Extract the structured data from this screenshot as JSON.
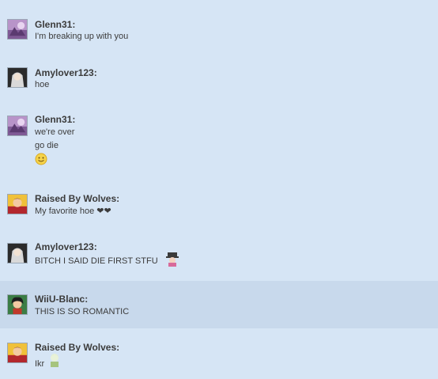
{
  "messages": [
    {
      "user": "Glenn31:",
      "lines": [
        "I'm breaking up with you"
      ]
    },
    {
      "user": "Amylover123:",
      "lines": [
        "hoe"
      ]
    },
    {
      "user": "Glenn31:",
      "lines": [
        "we're over",
        "go die"
      ],
      "emoji": "smiley-emoji"
    },
    {
      "user": "Raised By Wolves:",
      "lines": [
        "My favorite hoe ❤❤"
      ]
    },
    {
      "user": "Amylover123:",
      "lines": [
        "BITCH I SAID DIE FIRST STFU"
      ],
      "emoji": "character-sticker-emoji"
    },
    {
      "user": "WiiU-Blanc:",
      "lines": [
        "THIS IS SO ROMANTIC"
      ]
    },
    {
      "user": "Raised By Wolves:",
      "lines": [
        "Ikr"
      ],
      "emoji": "character-sticker-emoji"
    }
  ],
  "colors": {
    "background": "#d6e5f5",
    "highlight": "#c8d9ec",
    "text": "#3b3b3b"
  }
}
